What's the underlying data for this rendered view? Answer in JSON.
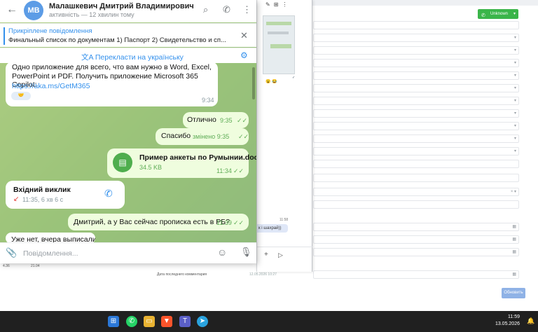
{
  "telegram": {
    "contact_name": "Малашкевич Дмитрий Владимирович",
    "avatar_initials": "МВ",
    "status": "активність — 12 хвилин тому",
    "pinned": {
      "title": "Прикріплене повідомлення",
      "text": "Финальный список по документам  1) Паспорт 2) Свидетельство и сп..."
    },
    "translate_label": "Перекласти на українську",
    "messages": {
      "promo": {
        "line1": "Одно приложение для всего, что вам нужно в Word, Excel,",
        "line2": "PowerPoint и PDF. Получить приложение Microsoft 365 Copilot:",
        "link": "https://aka.ms/GetM365",
        "time": "9:34"
      },
      "ok": {
        "text": "Отлично",
        "time": "9:35"
      },
      "thanks": {
        "text": "Спасибо",
        "time": "змінено 9:35"
      },
      "file": {
        "name": "Пример анкеты по Румынии.doc",
        "size": "34.5 KB",
        "time": "11:34"
      },
      "call": {
        "title": "Вхідний виклик",
        "meta": "11:35, 6 хв 6 с"
      },
      "question": {
        "text": "Дмитрий, а у Вас сейчас прописка есть в РБ?",
        "time": "11:39"
      },
      "partial": {
        "text": "Уже нет, вчера выписали"
      }
    },
    "input_placeholder": "Повідомлення..."
  },
  "crm": {
    "accept_label": "Unknown",
    "save_button": "Обновить",
    "comment_label": "Дата последнего комментария",
    "comment_date": "12.05.2026 10:27",
    "left_num1": "4.36",
    "left_num2": "21.04"
  },
  "preview_window": {
    "time": "11:58",
    "bubble_text": "к і шахрай))"
  },
  "taskbar": {
    "time": "11:59",
    "date": "13.05.2026"
  },
  "colors": {
    "telegram_accent": "#3390ec",
    "chat_background": "#a3c77d",
    "outgoing_bubble": "#effdde",
    "crm_accept": "#3bb54a"
  }
}
